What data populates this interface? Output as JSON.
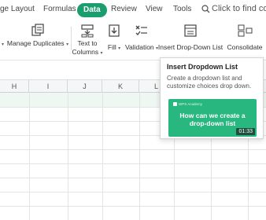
{
  "tabs": {
    "page_layout": "ge Layout",
    "formulas": "Formulas",
    "data": "Data",
    "review": "Review",
    "view": "View",
    "tools": "Tools"
  },
  "search": {
    "placeholder": "Click to find co"
  },
  "ribbon": {
    "manage_duplicates": "Manage Duplicates",
    "text_to_columns_line1": "Text to",
    "text_to_columns_line2": "Columns",
    "fill": "Fill",
    "validation": "Validation",
    "insert_dropdown": "Insert Drop-Down List",
    "consolidate": "Consolidate"
  },
  "columns": [
    "H",
    "I",
    "J",
    "K",
    "L"
  ],
  "tooltip": {
    "title": "Insert Dropdown List",
    "description": "Create a dropdown list and customize choices drop down.",
    "video_brand": "WPS Academy",
    "video_title": "How can we create a drop-down list",
    "video_duration": "01:33"
  },
  "colors": {
    "accent": "#1a9e6e",
    "video_bg": "#27b77f"
  }
}
